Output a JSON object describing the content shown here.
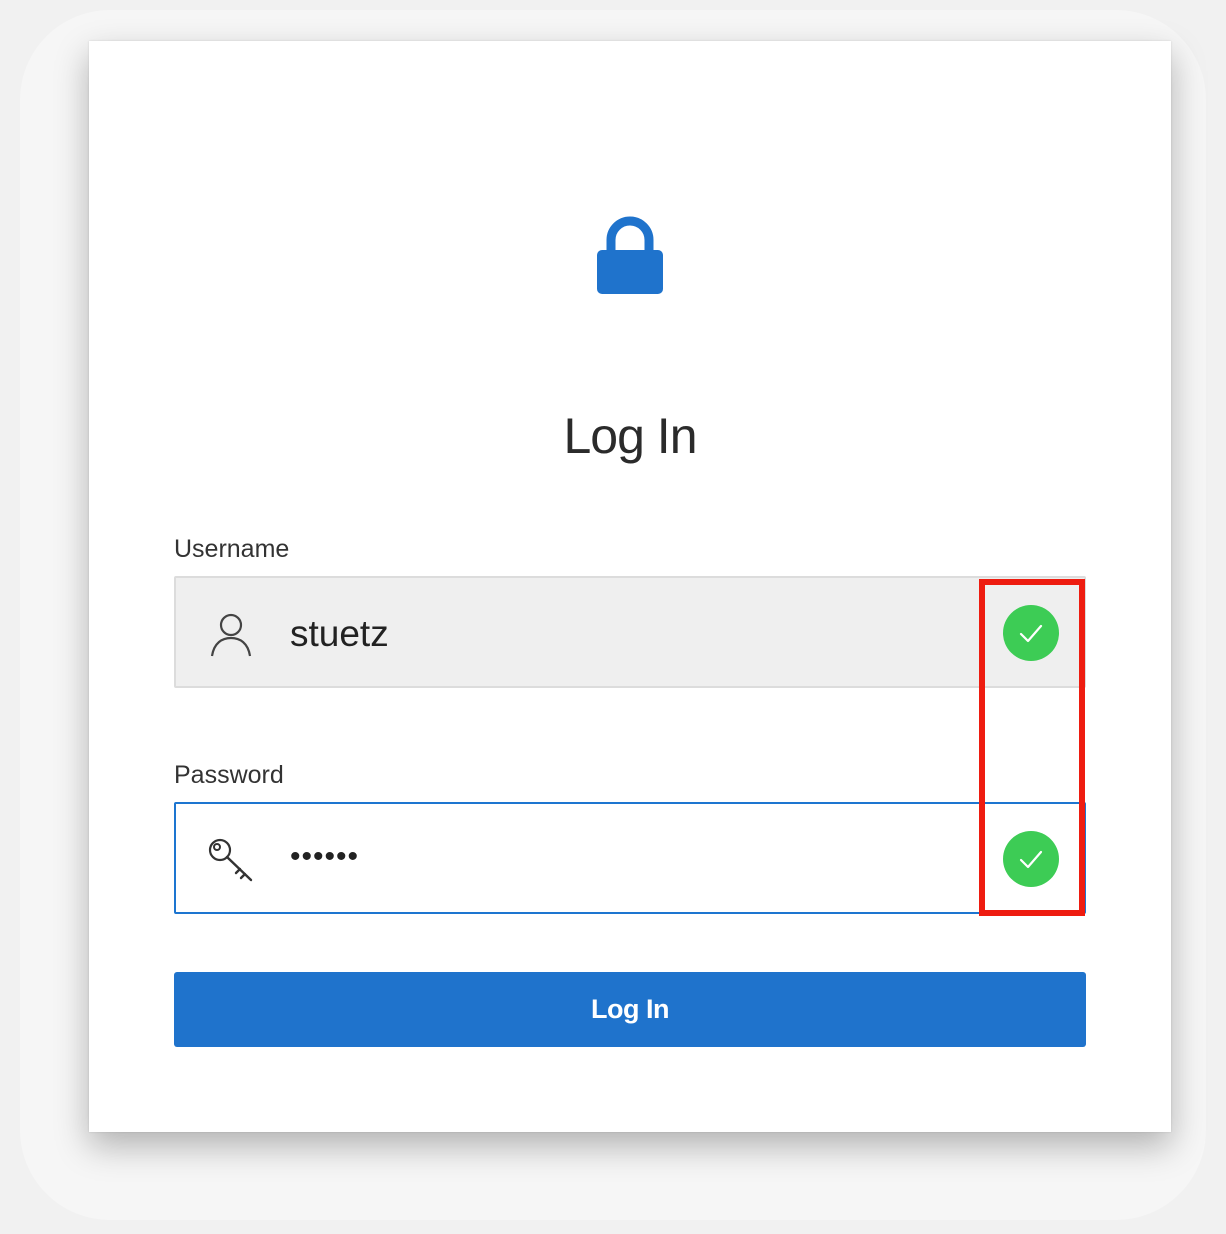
{
  "dialog": {
    "lock_icon": "lock-icon",
    "title": "Log In",
    "accent_color": "#1f73cc"
  },
  "username": {
    "label": "Username",
    "value": "stuetz",
    "icon": "user-icon",
    "status_icon": "check-circle-icon"
  },
  "password": {
    "label": "Password",
    "value": "••••••",
    "icon": "key-icon",
    "status_icon": "check-circle-icon"
  },
  "submit": {
    "label": "Log In"
  },
  "annotation": {
    "color": "#ee1c10",
    "target": "validation check icons"
  },
  "status_color": "#3dcc55"
}
